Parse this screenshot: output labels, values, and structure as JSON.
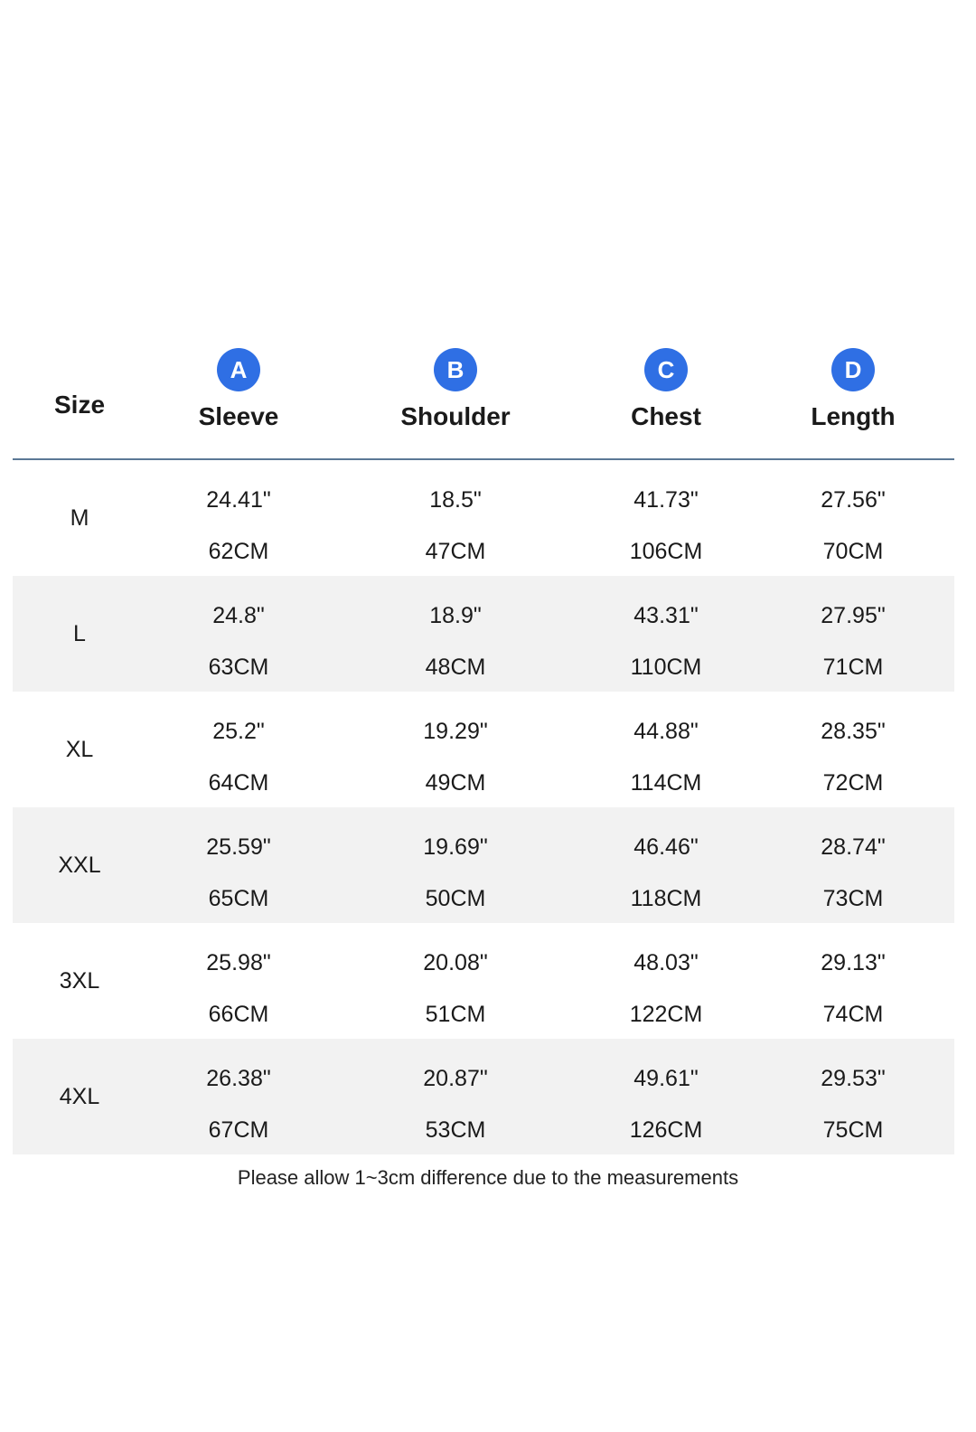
{
  "header": {
    "size_label": "Size",
    "columns": [
      {
        "badge": "A",
        "label": "Sleeve"
      },
      {
        "badge": "B",
        "label": "Shoulder"
      },
      {
        "badge": "C",
        "label": "Chest"
      },
      {
        "badge": "D",
        "label": "Length"
      }
    ]
  },
  "colors": {
    "badge": "#2f6fe4",
    "divider": "#5b7896",
    "shaded_row": "#f2f2f2"
  },
  "rows": [
    {
      "size": "M",
      "cells": [
        {
          "inch": "24.41\"",
          "cm": "62CM"
        },
        {
          "inch": "18.5\"",
          "cm": "47CM"
        },
        {
          "inch": "41.73\"",
          "cm": "106CM"
        },
        {
          "inch": "27.56\"",
          "cm": "70CM"
        }
      ]
    },
    {
      "size": "L",
      "cells": [
        {
          "inch": "24.8\"",
          "cm": "63CM"
        },
        {
          "inch": "18.9\"",
          "cm": "48CM"
        },
        {
          "inch": "43.31\"",
          "cm": "110CM"
        },
        {
          "inch": "27.95\"",
          "cm": "71CM"
        }
      ]
    },
    {
      "size": "XL",
      "cells": [
        {
          "inch": "25.2\"",
          "cm": "64CM"
        },
        {
          "inch": "19.29\"",
          "cm": "49CM"
        },
        {
          "inch": "44.88\"",
          "cm": "114CM"
        },
        {
          "inch": "28.35\"",
          "cm": "72CM"
        }
      ]
    },
    {
      "size": "XXL",
      "cells": [
        {
          "inch": "25.59\"",
          "cm": "65CM"
        },
        {
          "inch": "19.69\"",
          "cm": "50CM"
        },
        {
          "inch": "46.46\"",
          "cm": "118CM"
        },
        {
          "inch": "28.74\"",
          "cm": "73CM"
        }
      ]
    },
    {
      "size": "3XL",
      "cells": [
        {
          "inch": "25.98\"",
          "cm": "66CM"
        },
        {
          "inch": "20.08\"",
          "cm": "51CM"
        },
        {
          "inch": "48.03\"",
          "cm": "122CM"
        },
        {
          "inch": "29.13\"",
          "cm": "74CM"
        }
      ]
    },
    {
      "size": "4XL",
      "cells": [
        {
          "inch": "26.38\"",
          "cm": "67CM"
        },
        {
          "inch": "20.87\"",
          "cm": "53CM"
        },
        {
          "inch": "49.61\"",
          "cm": "126CM"
        },
        {
          "inch": "29.53\"",
          "cm": "75CM"
        }
      ]
    }
  ],
  "note": "Please allow 1~3cm difference due to the measurements"
}
